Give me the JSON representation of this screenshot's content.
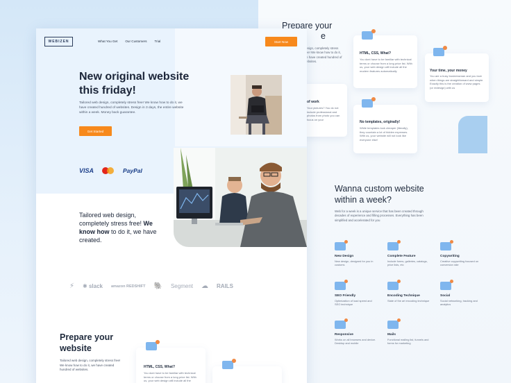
{
  "app": {
    "logo": "WEBIZEN",
    "nav": [
      "What You Get",
      "Our Customers",
      "Trial"
    ],
    "start_button": "Start Now"
  },
  "hero": {
    "title": "New original website this friday!",
    "text": "Tailored web design, completely stress free! We know how to do it, we have created hundred of websites. Design in 3 days, the entire website within a week. Money back guarantee.",
    "cta": "Get Started"
  },
  "payments": [
    "VISA",
    "PayPal"
  ],
  "tagline": {
    "line1": "Tailored web design, completely stress free!",
    "bold": "We know how",
    "line2": "to do it, we have created."
  },
  "logos": [
    "slack",
    "amazon REDSHIFT",
    "Segment",
    "RAILS"
  ],
  "prepare": {
    "heading": "Prepare your website",
    "text": "Tailored web design, completely stress free! We know how to do it, we have created hundred of websites."
  },
  "back": {
    "heading_top": "Prepare your",
    "heading_bottom": "e",
    "text_frag": "design, completely stress free! We know how to do it, we have created hundred of websites.",
    "cards": [
      {
        "title": "HTML, CSS, What?",
        "text": "You dont have to be familiar with technical terms or choose from a long price list. With us, your web design will include all the modern features automatically"
      },
      {
        "title": "Your time, your money",
        "text": "You are a busy businessman and you love when things are straightforward and simple. Exactly this is the creation of www pages (or redesign) with us"
      },
      {
        "title": "of work",
        "text": "Your pictures? You do not include professional and photos from photo you can focus on your"
      },
      {
        "title": "No templates, originally!",
        "text": "While templates look cheaper (literally), they countain a lot of hidden expenses. With us, your website will not look like everyone else!"
      }
    ],
    "custom": {
      "heading": "Wanna custom website within a week?",
      "text": "Web for a week is a unique service that has been created through decades of experience and filling processes. Everything has been simplified and accelerated for you"
    },
    "features": [
      {
        "title": "New Design",
        "text": "New design, designed for you in customs"
      },
      {
        "title": "Complete Feature",
        "text": "Include forms, galleries, catalogs, price lists, etc"
      },
      {
        "title": "Copywriting",
        "text": "Creative copywriting focused on conversion rate"
      },
      {
        "title": "SEO Friendly",
        "text": "Optimization of load speed and SEO technique"
      },
      {
        "title": "Encoding Technique",
        "text": "State of the art encoding technique"
      },
      {
        "title": "Social",
        "text": "Social networking, tracking and analytics"
      },
      {
        "title": "Responsive",
        "text": "Works on all browsers and device. Desktop and mobile"
      },
      {
        "title": "Mails",
        "text": "Functional mailing list, funnels and forms for marketing"
      }
    ]
  },
  "colors": {
    "accent": "#f7891c",
    "hero_bg": "#e9f3fd",
    "icon_blue": "#7fb6ee"
  }
}
